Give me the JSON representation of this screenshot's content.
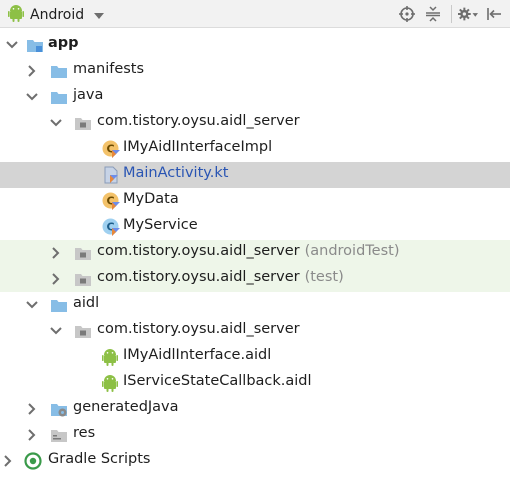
{
  "toolbar": {
    "view_name": "Android",
    "icons": [
      "android-icon",
      "dropdown-caret-icon",
      "locate-target-icon",
      "collapse-all-icon",
      "gear-icon",
      "hide-panel-icon"
    ]
  },
  "tree": {
    "app": "app",
    "manifests": "manifests",
    "java": "java",
    "pkg_main": "com.tistory.oysu.aidl_server",
    "file_impl": "IMyAidlInterfaceImpl",
    "file_main": "MainActivity.kt",
    "file_mydata": "MyData",
    "file_myservice": "MyService",
    "pkg_android_test": "com.tistory.oysu.aidl_server",
    "pkg_android_test_suffix": "(androidTest)",
    "pkg_test": "com.tistory.oysu.aidl_server",
    "pkg_test_suffix": "(test)",
    "aidl": "aidl",
    "pkg_aidl": "com.tistory.oysu.aidl_server",
    "file_aidl_iface": "IMyAidlInterface.aidl",
    "file_aidl_callback": "IServiceStateCallback.aidl",
    "generated_java": "generatedJava",
    "res": "res",
    "gradle_scripts": "Gradle Scripts"
  },
  "colors": {
    "selected_row": "#d4d4d4",
    "test_row": "#eef6e9",
    "folder": "#87bde6",
    "android_green": "#8dc046",
    "selected_text": "#2a55b3"
  }
}
